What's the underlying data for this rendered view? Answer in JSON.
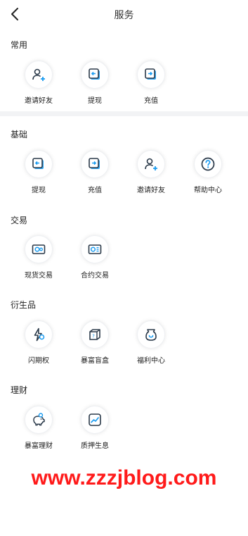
{
  "header": {
    "title": "服务"
  },
  "sections": {
    "common": {
      "title": "常用",
      "items": [
        {
          "label": "邀请好友",
          "icon": "invite-user-icon"
        },
        {
          "label": "提现",
          "icon": "withdraw-icon"
        },
        {
          "label": "充值",
          "icon": "deposit-icon"
        }
      ]
    },
    "basic": {
      "title": "基础",
      "items": [
        {
          "label": "提现",
          "icon": "withdraw-icon"
        },
        {
          "label": "充值",
          "icon": "deposit-icon"
        },
        {
          "label": "邀请好友",
          "icon": "invite-user-icon"
        },
        {
          "label": "帮助中心",
          "icon": "help-icon"
        }
      ]
    },
    "trade": {
      "title": "交易",
      "items": [
        {
          "label": "现货交易",
          "icon": "spot-trade-icon"
        },
        {
          "label": "合约交易",
          "icon": "contract-trade-icon"
        }
      ]
    },
    "derivatives": {
      "title": "衍生品",
      "items": [
        {
          "label": "闪期权",
          "icon": "flash-option-icon"
        },
        {
          "label": "暴富盲盒",
          "icon": "blind-box-icon"
        },
        {
          "label": "福利中心",
          "icon": "welfare-center-icon"
        }
      ]
    },
    "finance": {
      "title": "理财",
      "items": [
        {
          "label": "暴富理财",
          "icon": "piggy-bank-icon"
        },
        {
          "label": "质押生息",
          "icon": "staking-chart-icon"
        }
      ]
    }
  },
  "watermark": "www.zzzjblog.com",
  "colors": {
    "accent_blue": "#1a9bf0",
    "icon_dark": "#2b3a4a",
    "watermark_red": "#ff1a1a",
    "divider": "#f2f3f5"
  }
}
